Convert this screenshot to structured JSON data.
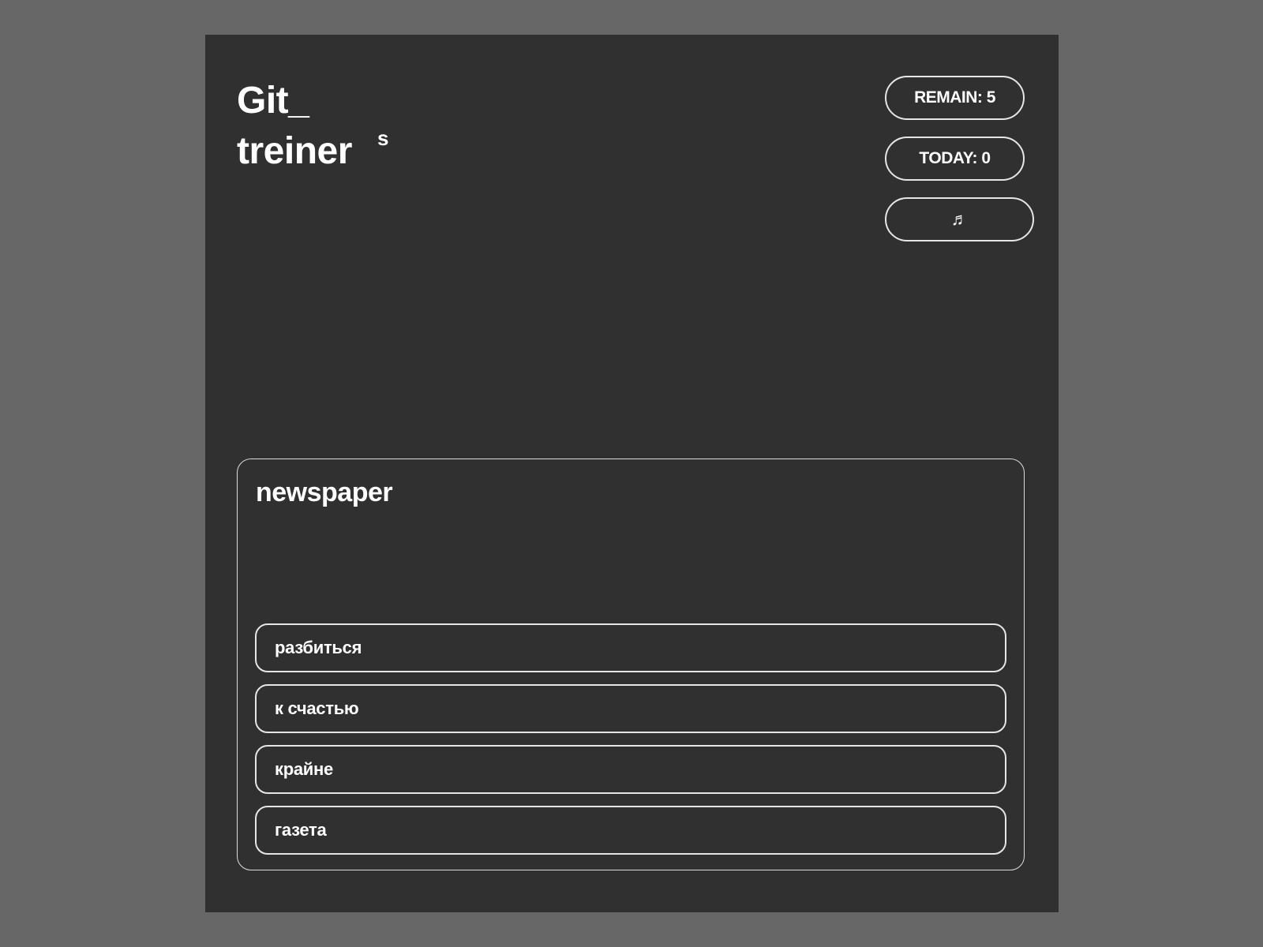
{
  "app": {
    "title_line1": "Git_",
    "title_line2": "treiner",
    "title_superscript": "s"
  },
  "stats": {
    "remain_label": "REMAIN: 5",
    "today_label": "TODAY: 0",
    "music_label": "♬"
  },
  "quiz": {
    "word": "newspaper",
    "options": [
      "разбиться",
      "к счастью",
      "крайне",
      "газета"
    ]
  },
  "colors": {
    "page_background": "#676767",
    "panel_background": "#303030",
    "text": "#ffffff",
    "border": "#e6e6e6"
  },
  "icons": {
    "music": "music-note-icon"
  }
}
